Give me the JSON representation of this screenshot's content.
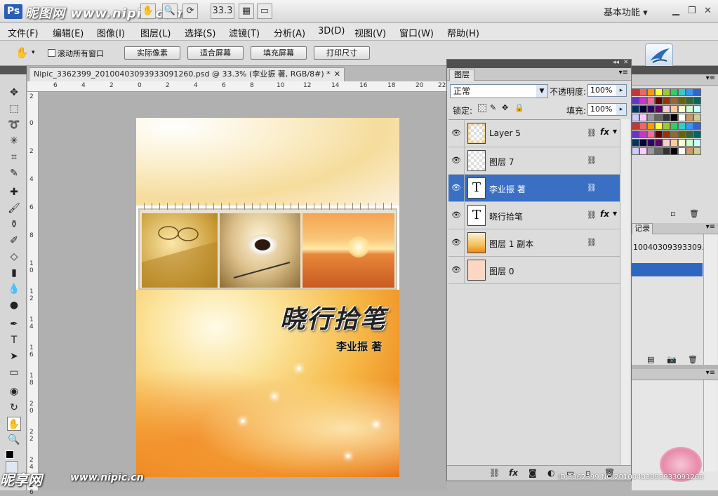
{
  "watermark": {
    "top": "www.nipic.com",
    "top_logo": "昵图网",
    "bottom_logo": "昵享网",
    "bottom_url": "www.nipic.cn",
    "id_line": "ID:3362399 NO:20100403093933091260"
  },
  "appbar": {
    "logo": "Ps",
    "icons": [
      "zoom-icon",
      "hand-icon",
      "arrange-icon"
    ],
    "zoom_value": "33.3",
    "workspace_label": "基本功能"
  },
  "menubar": {
    "items": [
      "文件(F)",
      "编辑(E)",
      "图像(I)",
      "图层(L)",
      "选择(S)",
      "滤镜(T)",
      "分析(A)",
      "3D(D)",
      "视图(V)",
      "窗口(W)",
      "帮助(H)"
    ]
  },
  "options": {
    "scroll_all_label": "滚动所有窗口",
    "buttons": [
      "实际像素",
      "适合屏幕",
      "填充屏幕",
      "打印尺寸"
    ]
  },
  "document": {
    "tab_title": "Nipic_3362399_20100403093933091260.psd @ 33.3% (李业振 著, RGB/8#) *",
    "ruler_h": [
      "6",
      "4",
      "2",
      "0",
      "2",
      "4",
      "6",
      "8",
      "10",
      "12",
      "14",
      "16",
      "18",
      "20",
      "22"
    ],
    "ruler_v": [
      "2",
      "0",
      "2",
      "4",
      "6",
      "8",
      "1 0",
      "1 2",
      "1 4",
      "1 6",
      "1 8",
      "2 0",
      "2 2",
      "2 4",
      "2 6"
    ],
    "title_text": "晓行拾笔",
    "author_text": "李业振 著"
  },
  "layers_panel": {
    "tab": "图层",
    "blend_mode": "正常",
    "opacity_label": "不透明度:",
    "opacity_value": "100%",
    "lock_label": "锁定:",
    "fill_label": "填充:",
    "fill_value": "100%",
    "layers": [
      {
        "name": "Layer 5",
        "thumb": "checker-gold",
        "link": true,
        "fx": true,
        "selected": false
      },
      {
        "name": "图层 7",
        "thumb": "checker",
        "link": true,
        "fx": false,
        "selected": false
      },
      {
        "name": "李业振 著",
        "thumb": "text",
        "link": true,
        "fx": false,
        "selected": true
      },
      {
        "name": "晓行拾笔",
        "thumb": "text",
        "link": true,
        "fx": true,
        "selected": false
      },
      {
        "name": "图层 1 副本",
        "thumb": "gradient",
        "link": true,
        "fx": false,
        "selected": false
      },
      {
        "name": "图层 0",
        "thumb": "peach",
        "link": false,
        "fx": false,
        "selected": false
      }
    ]
  },
  "history": {
    "tab": "记录",
    "item": "10040309393309..."
  },
  "colors": {
    "selection": "#3a6fc4",
    "panel_dark": "#505050"
  }
}
